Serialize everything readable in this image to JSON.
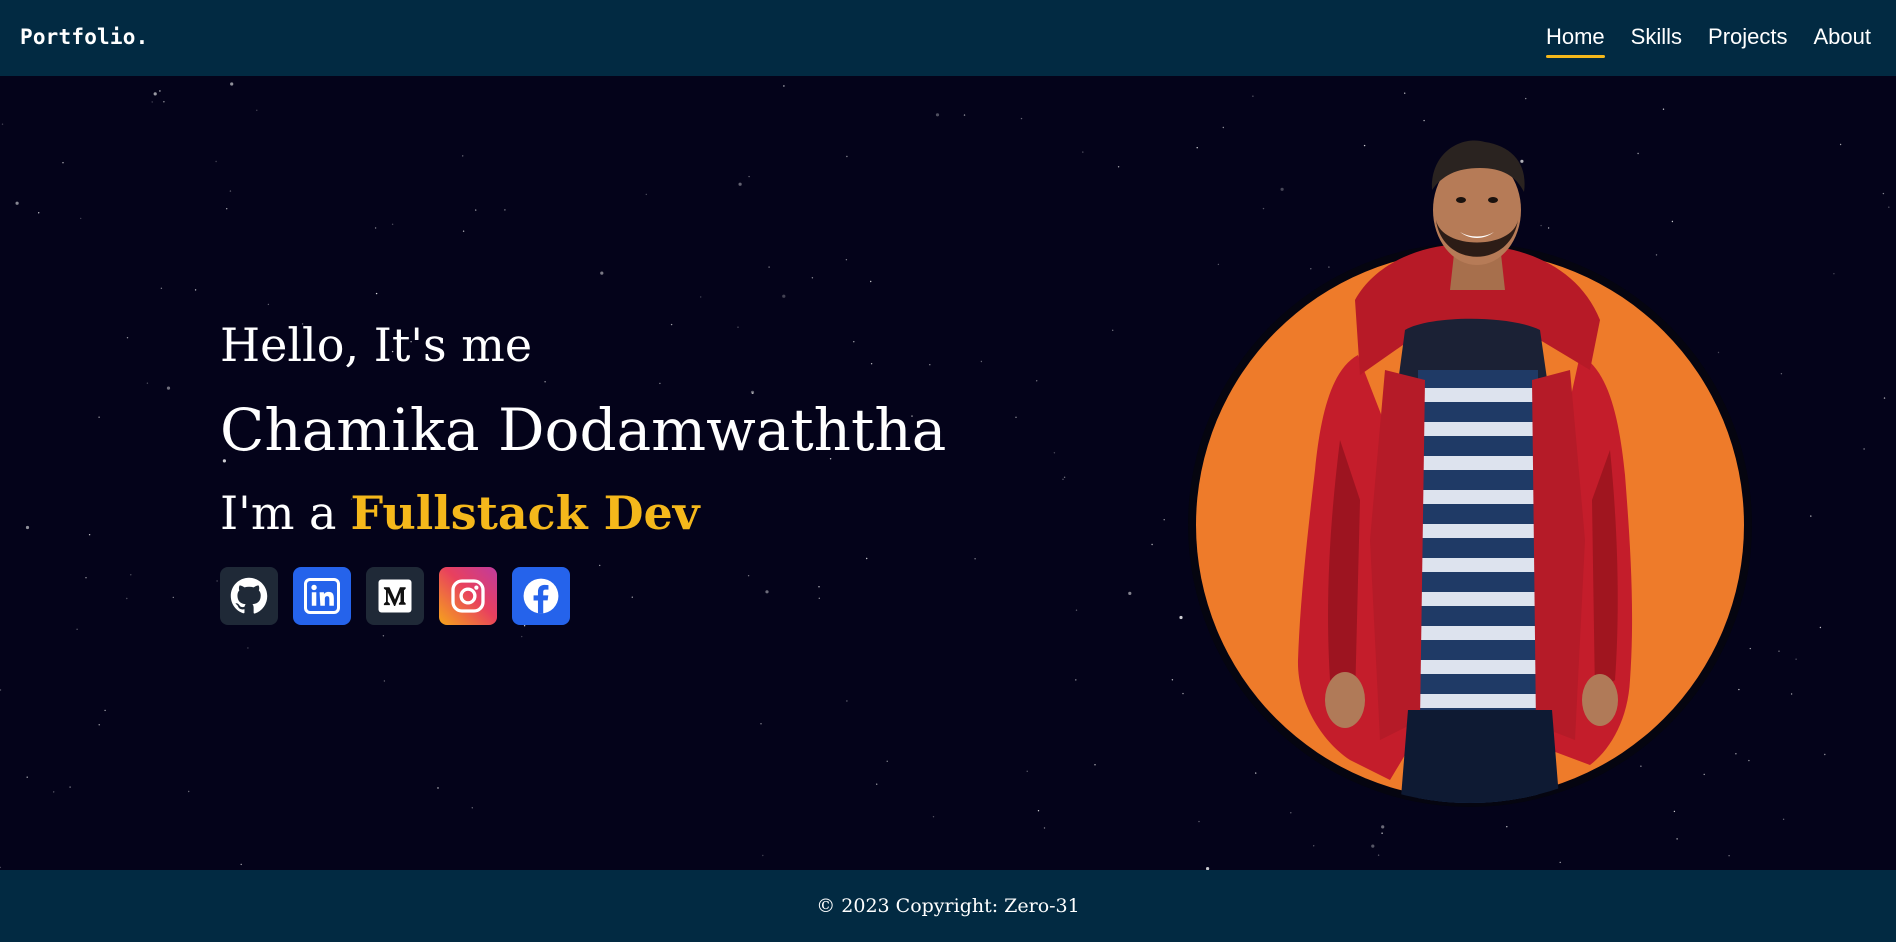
{
  "navbar": {
    "brand": "Portfolio.",
    "links": [
      {
        "label": "Home",
        "active": true
      },
      {
        "label": "Skills",
        "active": false
      },
      {
        "label": "Projects",
        "active": false
      },
      {
        "label": "About",
        "active": false
      }
    ]
  },
  "hero": {
    "greeting": "Hello, It's me",
    "name": "Chamika Dodamwaththa",
    "role_prefix": "I'm a",
    "role": "Fullstack Dev",
    "socials": [
      {
        "icon": "github-icon",
        "color": "#1f2937"
      },
      {
        "icon": "linkedin-icon",
        "color": "#2563eb"
      },
      {
        "icon": "medium-icon",
        "color": "#1f2937"
      },
      {
        "icon": "instagram-icon",
        "color": "#e1306c"
      },
      {
        "icon": "facebook-icon",
        "color": "#2563eb"
      }
    ]
  },
  "footer": {
    "copyright": "© 2023 Copyright: Zero-31"
  },
  "colors": {
    "background": "#04031a",
    "navbar": "#022a42",
    "accent": "#f5b81b",
    "portrait_circle": "#ee7b2a"
  }
}
